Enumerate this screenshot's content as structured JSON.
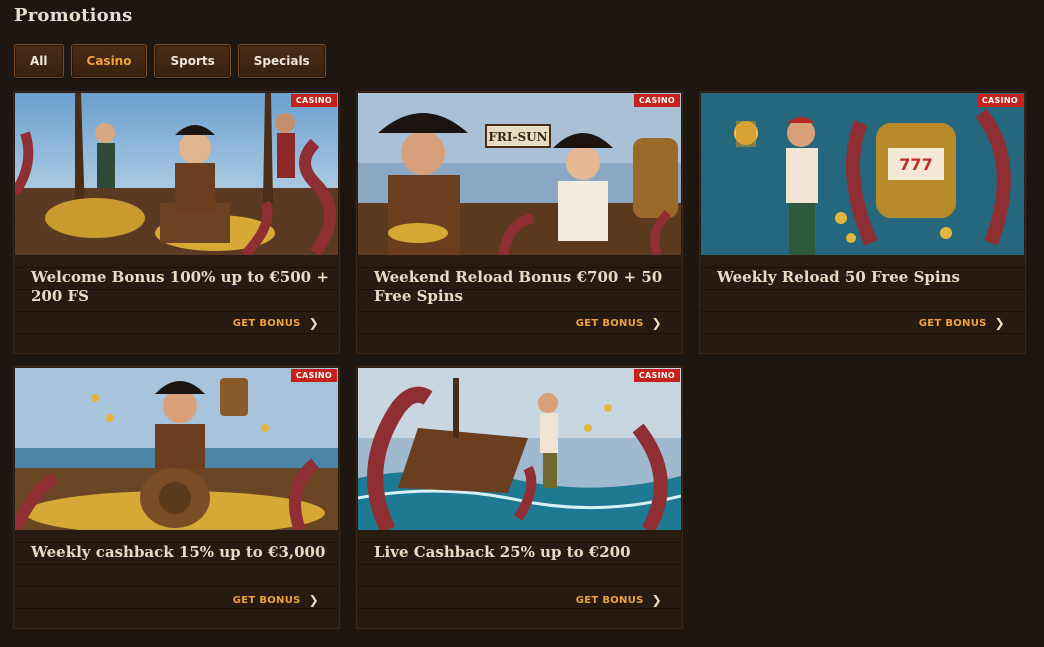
{
  "page": {
    "title": "Promotions"
  },
  "filters": [
    {
      "label": "All",
      "active": false
    },
    {
      "label": "Casino",
      "active": true
    },
    {
      "label": "Sports",
      "active": false
    },
    {
      "label": "Specials",
      "active": false
    }
  ],
  "cards": [
    {
      "badge": "CASINO",
      "title": "Welcome Bonus 100% up to €500 + 200 FS",
      "cta": "GET BONUS"
    },
    {
      "badge": "CASINO",
      "title": "Weekend Reload Bonus €700 + 50 Free Spins",
      "cta": "GET BONUS"
    },
    {
      "badge": "CASINO",
      "title": "Weekly Reload 50 Free Spins",
      "cta": "GET BONUS"
    },
    {
      "badge": "CASINO",
      "title": "Weekly cashback 15% up to €3,000",
      "cta": "GET BONUS"
    },
    {
      "badge": "CASINO",
      "title": "Live Cashback 25% up to €200",
      "cta": "GET BONUS"
    }
  ],
  "art": {
    "sign_text": "FRI-SUN",
    "colors": {
      "accent": "#f0a23b",
      "badge": "#c6221b",
      "bg": "#1e1611"
    }
  }
}
